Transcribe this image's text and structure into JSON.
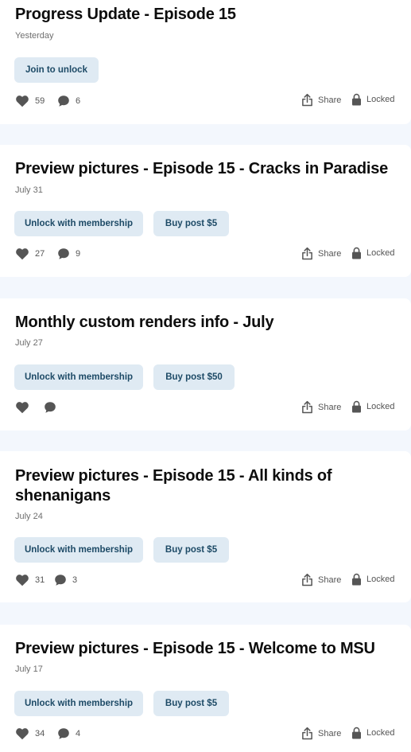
{
  "posts": [
    {
      "title": "Progress Update - Episode 15",
      "date": "Yesterday",
      "unlock_label": "Join to unlock",
      "buy_label": "",
      "likes": "59",
      "comments": "6"
    },
    {
      "title": "Preview pictures - Episode 15 - Cracks in Paradise",
      "date": "July 31",
      "unlock_label": "Unlock with membership",
      "buy_label": "Buy post $5",
      "likes": "27",
      "comments": "9"
    },
    {
      "title": "Monthly custom renders info - July",
      "date": "July 27",
      "unlock_label": "Unlock with membership",
      "buy_label": "Buy post $50",
      "likes": "",
      "comments": ""
    },
    {
      "title": "Preview pictures - Episode 15 - All kinds of shenanigans",
      "date": "July 24",
      "unlock_label": "Unlock with membership",
      "buy_label": "Buy post $5",
      "likes": "31",
      "comments": "3"
    },
    {
      "title": "Preview pictures - Episode 15 - Welcome to MSU",
      "date": "July 17",
      "unlock_label": "Unlock with membership",
      "buy_label": "Buy post $5",
      "likes": "34",
      "comments": "4"
    }
  ],
  "actions": {
    "share_label": "Share",
    "locked_label": "Locked"
  },
  "icons": {
    "like": "heart-icon",
    "comment": "comment-icon",
    "share": "share-icon",
    "lock": "lock-icon"
  },
  "colors": {
    "page_bg": "#f3f7fd",
    "button_bg": "#dfeaf3",
    "button_text": "#1d4a66"
  }
}
